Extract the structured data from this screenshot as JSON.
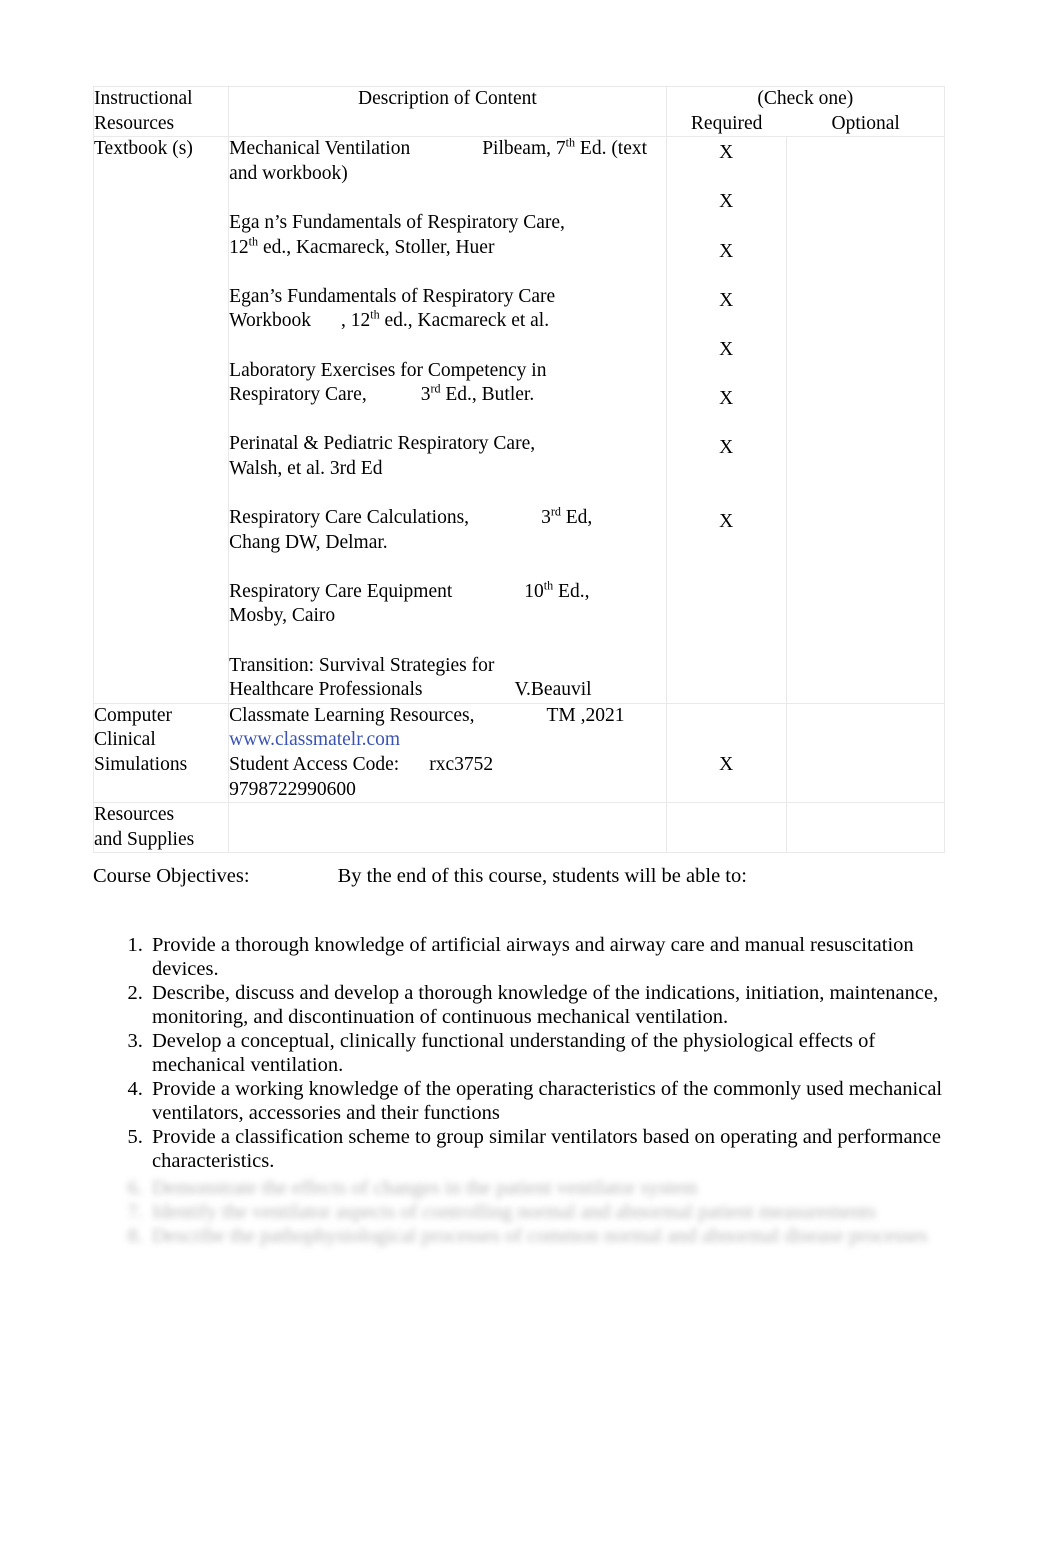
{
  "table": {
    "headers": {
      "col1": "Instructional Resources",
      "col1_line1": "Instructional",
      "col1_line2": "Resources",
      "col2": "Description of Content",
      "check_one": "(Check one)",
      "required": "Required",
      "optional": "Optional"
    },
    "rows": [
      {
        "resource": "Textbook (s)",
        "items": [
          {
            "lines": [
              "Mechanical Ventilation",
              "Pilbeam, 7",
              "th",
              " Ed. (text",
              "and workbook)"
            ],
            "title": "Mechanical Ventilation",
            "author": "Pilbeam, 7",
            "sup": "th",
            "edition_tail": " Ed. (text",
            "line2": "and workbook)",
            "required": "X",
            "optional": ""
          },
          {
            "title": "Ega n’s Fundamentals of Respiratory Care,",
            "line2_pre": "12",
            "sup": "th",
            "line2_post": " ed., Kacmareck, Stoller, Huer",
            "required": "X",
            "optional": ""
          },
          {
            "title": "Egan’s Fundamentals of Respiratory Care",
            "line2_pre": "Workbook",
            "line2_mid": ", 12",
            "sup": "th",
            "line2_post": " ed., Kacmareck et al.",
            "required": "X",
            "optional": ""
          },
          {
            "title": "Laboratory Exercises for Competency in",
            "line2_pre": "Respiratory Care,",
            "line2_num": "3",
            "sup": "rd",
            "line2_post": " Ed., Butler.",
            "required": "X",
            "optional": ""
          },
          {
            "title": "Perinatal & Pediatric Respiratory Care,",
            "line2": "Walsh, et al. 3rd Ed",
            "required": "X",
            "optional": ""
          },
          {
            "title": "Respiratory Care Calculations,",
            "title_num": "3",
            "sup": "rd",
            "title_post": " Ed,",
            "line2": "Chang DW, Delmar.",
            "required": "X",
            "optional": ""
          },
          {
            "title": "Respiratory Care Equipment",
            "title_num": "10",
            "sup": "th",
            "title_post": " Ed.,",
            "line2": "Mosby, Cairo",
            "required": "X",
            "optional": ""
          },
          {
            "title": "Transition: Survival Strategies for",
            "line2": "Healthcare Professionals",
            "line2_author": "V.Beauvil",
            "required": "X",
            "optional": ""
          }
        ]
      },
      {
        "resource_line1": "Computer",
        "resource_line2": "Clinical",
        "resource_line3": "Simulations",
        "content_line1": "Classmate Learning Resources,",
        "content_line1_tm": "TM ,2021",
        "content_link": "www.classmatelr.com",
        "content_line3_label": "Student Access Code:",
        "content_line3_code": "rxc3752",
        "content_line4": "9798722990600",
        "required": "X",
        "optional": ""
      },
      {
        "resource_line1": "Resources",
        "resource_line2": "and Supplies",
        "content": "",
        "required": "",
        "optional": ""
      }
    ]
  },
  "objectives": {
    "label": "Course Objectives:",
    "lead": "By the end of this course, students will be able to:",
    "items": [
      "Provide a thorough knowledge of artificial airways and airway care and manual resuscitation devices.",
      "Describe, discuss and develop a thorough knowledge of the indications, initiation, maintenance, monitoring, and discontinuation of continuous mechanical ventilation.",
      "Develop a conceptual, clinically functional understanding of the physiological effects of mechanical ventilation.",
      "Provide a working knowledge of the operating characteristics of the commonly used mechanical ventilators, accessories and their functions",
      "Provide a classification scheme to group similar ventilators based on operating and performance characteristics."
    ],
    "faded_items": [
      "Demonstrate the effects of changes in the patient ventilator system",
      "Identify the ventilator aspects of controlling normal and abnormal patient measurements",
      "Describe the pathophysiological processes of common normal and abnormal disease processes"
    ]
  },
  "colors": {
    "link": "#3a53b3",
    "border": "#e9e9e9",
    "text": "#000000"
  }
}
